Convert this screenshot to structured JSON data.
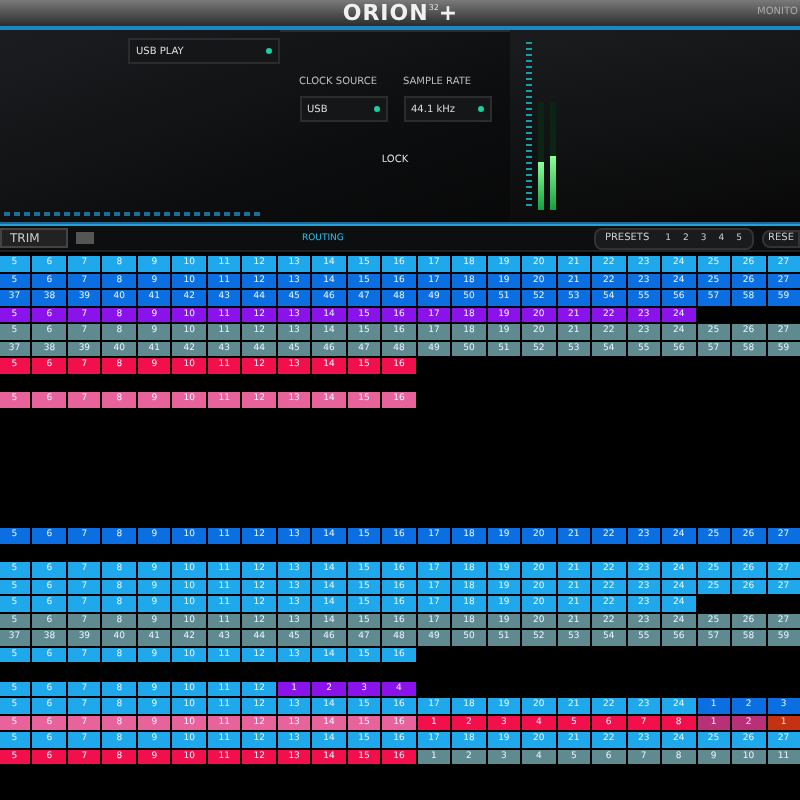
{
  "header": {
    "logo": "ORION",
    "logo_sup": "32",
    "logo_plus": "+",
    "right_label": "MONITO"
  },
  "panel": {
    "source": "USB PLAY",
    "clock_label": "CLOCK SOURCE",
    "clock_value": "USB",
    "rate_label": "SAMPLE RATE",
    "rate_value": "44.1 kHz",
    "lock": "LOCK"
  },
  "meters": [
    {
      "level": 0.45
    },
    {
      "level": 0.5
    }
  ],
  "toolbar": {
    "trim": "TRIM",
    "routing": "ROUTING",
    "presets": "PRESETS",
    "preset_numbers": [
      "1",
      "2",
      "3",
      "4",
      "5"
    ],
    "reset": "RESE"
  },
  "rows": [
    {
      "kind": "cells",
      "segments": [
        {
          "color": "#1fa9ec",
          "labels": [
            "5",
            "6",
            "7",
            "8",
            "9",
            "10",
            "11",
            "12",
            "13",
            "14",
            "15",
            "16",
            "17",
            "18",
            "19",
            "20",
            "21",
            "22",
            "23",
            "24",
            "25",
            "26",
            "27"
          ]
        }
      ]
    },
    {
      "kind": "cells",
      "segments": [
        {
          "color": "#0b6fe2",
          "labels": [
            "5",
            "6",
            "7",
            "8",
            "9",
            "10",
            "11",
            "12",
            "13",
            "14",
            "15",
            "16",
            "17",
            "18",
            "19",
            "20",
            "21",
            "22",
            "23",
            "24",
            "25",
            "26",
            "27"
          ]
        }
      ]
    },
    {
      "kind": "cells",
      "segments": [
        {
          "color": "#0b6fe2",
          "labels": [
            "37",
            "38",
            "39",
            "40",
            "41",
            "42",
            "43",
            "44",
            "45",
            "46",
            "47",
            "48",
            "49",
            "50",
            "51",
            "52",
            "53",
            "54",
            "55",
            "56",
            "57",
            "58",
            "59"
          ]
        }
      ]
    },
    {
      "kind": "cells",
      "segments": [
        {
          "color": "#8a12ea",
          "labels": [
            "5",
            "6",
            "7",
            "8",
            "9",
            "10",
            "11",
            "12",
            "13",
            "14",
            "15",
            "16",
            "17",
            "18",
            "19",
            "20",
            "21",
            "22",
            "23",
            "24"
          ]
        }
      ]
    },
    {
      "kind": "cells",
      "segments": [
        {
          "color": "#5f8a8f",
          "labels": [
            "5",
            "6",
            "7",
            "8",
            "9",
            "10",
            "11",
            "12",
            "13",
            "14",
            "15",
            "16",
            "17",
            "18",
            "19",
            "20",
            "21",
            "22",
            "23",
            "24",
            "25",
            "26",
            "27"
          ]
        }
      ]
    },
    {
      "kind": "cells",
      "segments": [
        {
          "color": "#5f8a8f",
          "labels": [
            "37",
            "38",
            "39",
            "40",
            "41",
            "42",
            "43",
            "44",
            "45",
            "46",
            "47",
            "48",
            "49",
            "50",
            "51",
            "52",
            "53",
            "54",
            "55",
            "56",
            "57",
            "58",
            "59"
          ]
        }
      ]
    },
    {
      "kind": "cells",
      "segments": [
        {
          "color": "#f2104c",
          "labels": [
            "5",
            "6",
            "7",
            "8",
            "9",
            "10",
            "11",
            "12",
            "13",
            "14",
            "15",
            "16"
          ]
        }
      ]
    },
    {
      "kind": "empty"
    },
    {
      "kind": "cells",
      "segments": [
        {
          "color": "#e8639c",
          "labels": [
            "5",
            "6",
            "7",
            "8",
            "9",
            "10",
            "11",
            "12",
            "13",
            "14",
            "15",
            "16"
          ]
        }
      ]
    },
    {
      "kind": "empty"
    },
    {
      "kind": "empty"
    },
    {
      "kind": "empty"
    },
    {
      "kind": "empty"
    },
    {
      "kind": "empty"
    },
    {
      "kind": "empty"
    },
    {
      "kind": "empty"
    },
    {
      "kind": "cells",
      "segments": [
        {
          "color": "#0b6fe2",
          "labels": [
            "5",
            "6",
            "7",
            "8",
            "9",
            "10",
            "11",
            "12",
            "13",
            "14",
            "15",
            "16",
            "17",
            "18",
            "19",
            "20",
            "21",
            "22",
            "23",
            "24",
            "25",
            "26",
            "27"
          ]
        }
      ]
    },
    {
      "kind": "empty"
    },
    {
      "kind": "cells",
      "segments": [
        {
          "color": "#1fa9ec",
          "labels": [
            "5",
            "6",
            "7",
            "8",
            "9",
            "10",
            "11",
            "12",
            "13",
            "14",
            "15",
            "16",
            "17",
            "18",
            "19",
            "20",
            "21",
            "22",
            "23",
            "24",
            "25",
            "26",
            "27"
          ]
        }
      ]
    },
    {
      "kind": "cells",
      "segments": [
        {
          "color": "#1fa9ec",
          "labels": [
            "5",
            "6",
            "7",
            "8",
            "9",
            "10",
            "11",
            "12",
            "13",
            "14",
            "15",
            "16",
            "17",
            "18",
            "19",
            "20",
            "21",
            "22",
            "23",
            "24",
            "25",
            "26",
            "27"
          ]
        }
      ]
    },
    {
      "kind": "cells",
      "segments": [
        {
          "color": "#1fa9ec",
          "labels": [
            "5",
            "6",
            "7",
            "8",
            "9",
            "10",
            "11",
            "12",
            "13",
            "14",
            "15",
            "16",
            "17",
            "18",
            "19",
            "20",
            "21",
            "22",
            "23",
            "24"
          ]
        }
      ]
    },
    {
      "kind": "cells",
      "segments": [
        {
          "color": "#5f8a8f",
          "labels": [
            "5",
            "6",
            "7",
            "8",
            "9",
            "10",
            "11",
            "12",
            "13",
            "14",
            "15",
            "16",
            "17",
            "18",
            "19",
            "20",
            "21",
            "22",
            "23",
            "24",
            "25",
            "26",
            "27"
          ]
        }
      ]
    },
    {
      "kind": "cells",
      "segments": [
        {
          "color": "#5f8a8f",
          "labels": [
            "37",
            "38",
            "39",
            "40",
            "41",
            "42",
            "43",
            "44",
            "45",
            "46",
            "47",
            "48",
            "49",
            "50",
            "51",
            "52",
            "53",
            "54",
            "55",
            "56",
            "57",
            "58",
            "59"
          ]
        }
      ]
    },
    {
      "kind": "cells",
      "segments": [
        {
          "color": "#1fa9ec",
          "labels": [
            "5",
            "6",
            "7",
            "8",
            "9",
            "10",
            "11",
            "12",
            "13",
            "14",
            "15",
            "16"
          ]
        }
      ]
    },
    {
      "kind": "empty"
    },
    {
      "kind": "cells",
      "segments": [
        {
          "color": "#1fa9ec",
          "labels": [
            "5",
            "6",
            "7",
            "8",
            "9",
            "10",
            "11",
            "12"
          ]
        },
        {
          "color": "#8a12ea",
          "labels": [
            "1",
            "2",
            "3",
            "4"
          ]
        }
      ]
    },
    {
      "kind": "cells",
      "segments": [
        {
          "color": "#1fa9ec",
          "labels": [
            "5",
            "6",
            "7",
            "8",
            "9",
            "10",
            "11",
            "12",
            "13",
            "14",
            "15",
            "16",
            "17",
            "18",
            "19",
            "20",
            "21",
            "22",
            "23",
            "24"
          ]
        },
        {
          "color": "#0b6fe2",
          "labels": [
            "1",
            "2",
            "3"
          ]
        }
      ]
    },
    {
      "kind": "cells",
      "segments": [
        {
          "color": "#e8639c",
          "labels": [
            "5",
            "6",
            "7",
            "8",
            "9",
            "10",
            "11",
            "12",
            "13",
            "14",
            "15",
            "16"
          ]
        },
        {
          "color": "#f2104c",
          "labels": [
            "1",
            "2",
            "3",
            "4",
            "5",
            "6",
            "7",
            "8"
          ]
        },
        {
          "color": "#b83078",
          "labels": [
            "1",
            "2"
          ]
        },
        {
          "color": "#c43212",
          "labels": [
            "1"
          ]
        }
      ]
    },
    {
      "kind": "cells",
      "segments": [
        {
          "color": "#1fa9ec",
          "labels": [
            "5",
            "6",
            "7",
            "8",
            "9",
            "10",
            "11",
            "12",
            "13",
            "14",
            "15",
            "16",
            "17",
            "18",
            "19",
            "20",
            "21",
            "22",
            "23",
            "24",
            "25",
            "26",
            "27"
          ]
        }
      ]
    },
    {
      "kind": "cells",
      "segments": [
        {
          "color": "#f2104c",
          "labels": [
            "5",
            "6",
            "7",
            "8",
            "9",
            "10",
            "11",
            "12",
            "13",
            "14",
            "15",
            "16"
          ]
        },
        {
          "color": "#5f8a8f",
          "labels": [
            "1",
            "2",
            "3",
            "4",
            "5",
            "6",
            "7",
            "8",
            "9",
            "10",
            "11"
          ]
        }
      ]
    }
  ]
}
